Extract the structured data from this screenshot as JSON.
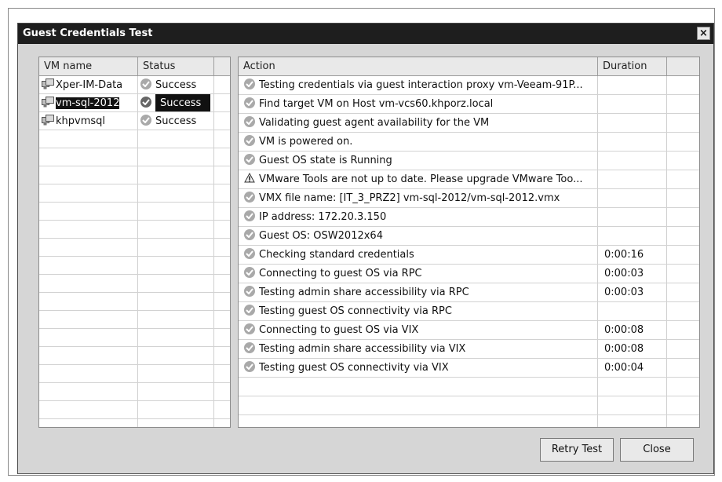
{
  "window": {
    "title": "Guest Credentials Test",
    "close_glyph": "×"
  },
  "vm_list": {
    "columns": [
      "VM name",
      "Status"
    ],
    "rows": [
      {
        "name": "Xper-IM-Data",
        "status": "Success",
        "selected": false
      },
      {
        "name": "vm-sql-2012",
        "status": "Success",
        "selected": true
      },
      {
        "name": "khpvmsql",
        "status": "Success",
        "selected": false
      }
    ]
  },
  "actions": {
    "columns": [
      "Action",
      "Duration"
    ],
    "rows": [
      {
        "icon": "check-icon",
        "action": "Testing credentials via guest interaction proxy vm-Veeam-91P...",
        "duration": ""
      },
      {
        "icon": "check-icon",
        "action": "Find target VM on Host vm-vcs60.khporz.local",
        "duration": ""
      },
      {
        "icon": "check-icon",
        "action": "Validating guest agent availability for the VM",
        "duration": ""
      },
      {
        "icon": "check-icon",
        "action": "VM is powered on.",
        "duration": ""
      },
      {
        "icon": "check-icon",
        "action": "Guest OS state is Running",
        "duration": ""
      },
      {
        "icon": "warning-icon",
        "action": "VMware Tools are not up to date. Please upgrade VMware Too...",
        "duration": ""
      },
      {
        "icon": "check-icon",
        "action": "VMX file name: [IT_3_PRZ2] vm-sql-2012/vm-sql-2012.vmx",
        "duration": ""
      },
      {
        "icon": "check-icon",
        "action": "IP address: 172.20.3.150",
        "duration": ""
      },
      {
        "icon": "check-icon",
        "action": "Guest OS: OSW2012x64",
        "duration": ""
      },
      {
        "icon": "check-icon",
        "action": "Checking standard credentials",
        "duration": "0:00:16"
      },
      {
        "icon": "check-icon",
        "action": "Connecting to guest OS via RPC",
        "duration": "0:00:03"
      },
      {
        "icon": "check-icon",
        "action": "Testing admin share accessibility via RPC",
        "duration": "0:00:03"
      },
      {
        "icon": "check-icon",
        "action": "Testing guest OS connectivity via RPC",
        "duration": ""
      },
      {
        "icon": "check-icon",
        "action": "Connecting to guest OS via VIX",
        "duration": "0:00:08"
      },
      {
        "icon": "check-icon",
        "action": "Testing admin share accessibility via VIX",
        "duration": "0:00:08"
      },
      {
        "icon": "check-icon",
        "action": "Testing guest OS connectivity via VIX",
        "duration": "0:00:04"
      }
    ]
  },
  "buttons": {
    "retry": "Retry Test",
    "close": "Close"
  }
}
